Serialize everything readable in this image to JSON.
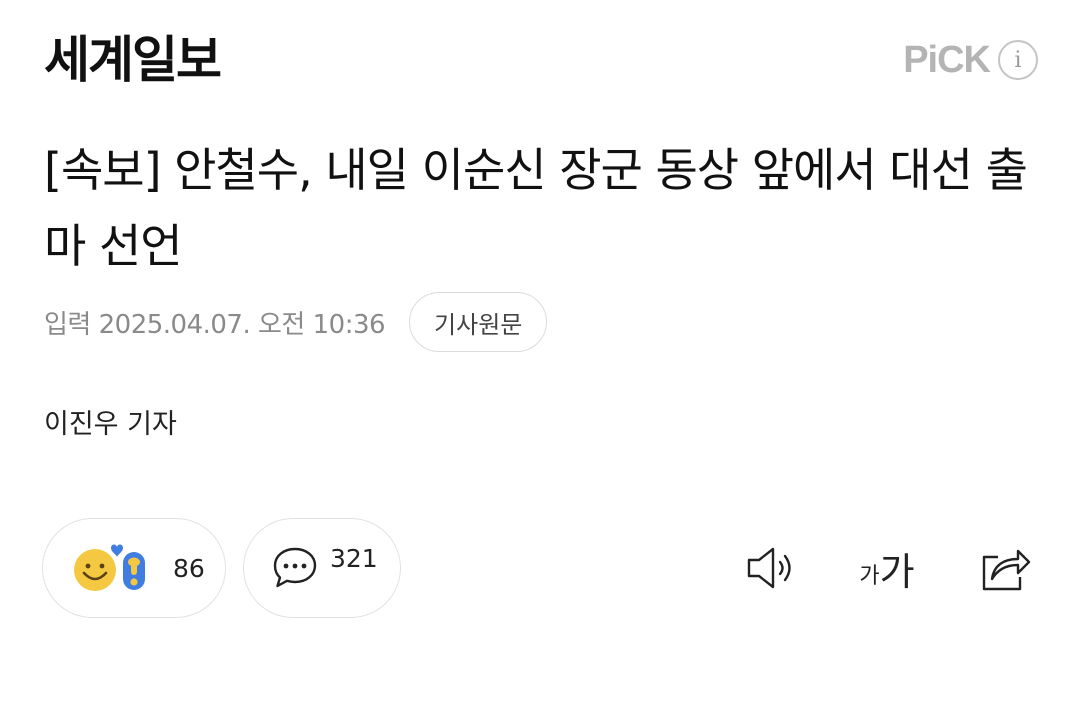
{
  "header": {
    "logo": "세계일보",
    "pick_label": "PiCK",
    "info_icon": "info-icon",
    "info_glyph": "i"
  },
  "article": {
    "title": "[속보] 안철수, 내일 이순신 장군 동상 앞에서 대선 출마 선언",
    "date": "입력 2025.04.07. 오전 10:36",
    "original_button": "기사원문",
    "byline": "이진우 기자"
  },
  "actions": {
    "reaction_count": "86",
    "comment_count": "321",
    "sound_icon": "speaker-icon",
    "font_small": "가",
    "font_large": "가",
    "share_icon": "share-icon"
  },
  "colors": {
    "pick_gray": "#b4b4b4",
    "meta_gray": "#8a8a8a",
    "border_gray": "#e2e2e2",
    "emoji_yellow": "#f5c842",
    "heart_blue": "#3f7de0"
  }
}
